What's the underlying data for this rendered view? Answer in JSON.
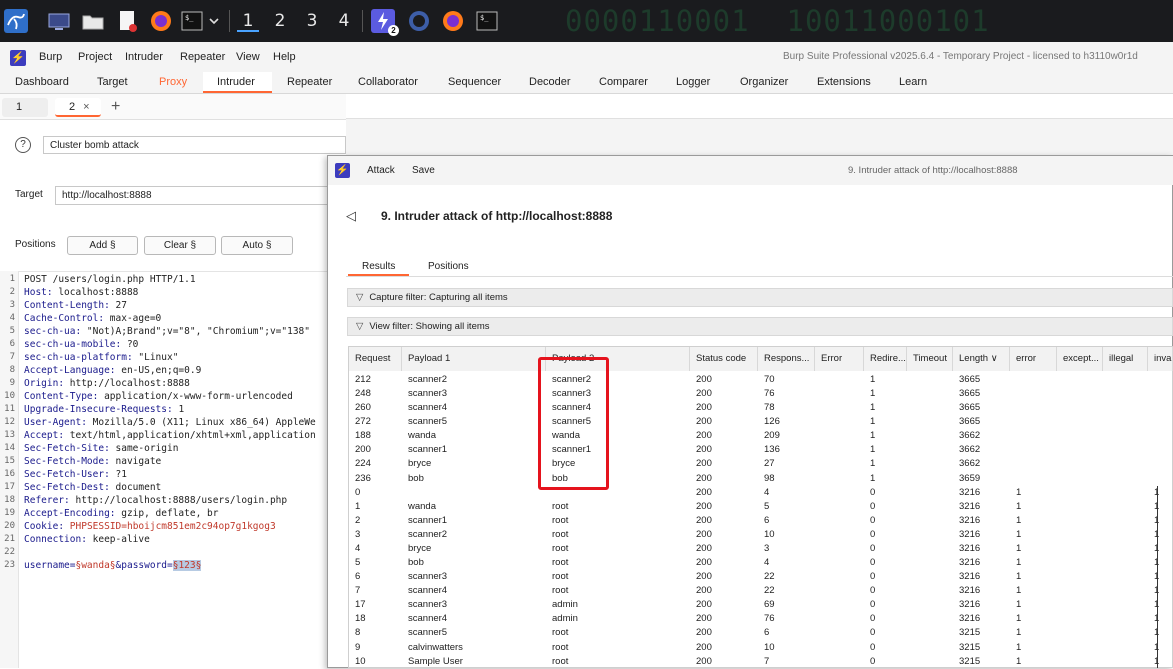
{
  "taskbar": {
    "workspaces": [
      "1",
      "2",
      "3",
      "4"
    ],
    "badge": "2",
    "binary_text": "0000110001  10011000101"
  },
  "menubar": {
    "items": [
      "Burp",
      "Project",
      "Intruder",
      "Repeater",
      "View",
      "Help"
    ],
    "window_title": "Burp Suite Professional v2025.6.4 - Temporary Project - licensed to h3110w0r1d"
  },
  "main_tabs": [
    "Dashboard",
    "Target",
    "Proxy",
    "Intruder",
    "Repeater"
  ],
  "secondary_tabs": [
    "Collaborator",
    "Sequencer",
    "Decoder",
    "Comparer",
    "Logger",
    "Organizer",
    "Extensions",
    "Learn"
  ],
  "intruder_tabs": [
    {
      "label": "1",
      "close": ""
    },
    {
      "label": "2",
      "close": "×"
    }
  ],
  "add_tab": "+",
  "attack_type": "Cluster bomb attack",
  "target": {
    "label": "Target",
    "value": "http://localhost:8888"
  },
  "positions": {
    "label": "Positions",
    "add": "Add §",
    "clear": "Clear §",
    "auto": "Auto §"
  },
  "request_lines": [
    {
      "n": "1",
      "text": "POST /users/login.php HTTP/1.1"
    },
    {
      "n": "2",
      "h": "Host",
      "v": " localhost:8888"
    },
    {
      "n": "3",
      "h": "Content-Length",
      "v": " 27"
    },
    {
      "n": "4",
      "h": "Cache-Control",
      "v": " max-age=0"
    },
    {
      "n": "5",
      "h": "sec-ch-ua",
      "v": " \"Not)A;Brand\";v=\"8\", \"Chromium\";v=\"138\""
    },
    {
      "n": "6",
      "h": "sec-ch-ua-mobile",
      "v": " ?0"
    },
    {
      "n": "7",
      "h": "sec-ch-ua-platform",
      "v": " \"Linux\""
    },
    {
      "n": "8",
      "h": "Accept-Language",
      "v": " en-US,en;q=0.9"
    },
    {
      "n": "9",
      "h": "Origin",
      "v": " http://localhost:8888"
    },
    {
      "n": "10",
      "h": "Content-Type",
      "v": " application/x-www-form-urlencoded"
    },
    {
      "n": "11",
      "h": "Upgrade-Insecure-Requests",
      "v": " 1"
    },
    {
      "n": "12",
      "h": "User-Agent",
      "v": " Mozilla/5.0 (X11; Linux x86_64) AppleWe"
    },
    {
      "n": "13",
      "h": "Accept",
      "v": " text/html,application/xhtml+xml,application"
    },
    {
      "n": "14",
      "h": "Sec-Fetch-Site",
      "v": " same-origin"
    },
    {
      "n": "15",
      "h": "Sec-Fetch-Mode",
      "v": " navigate"
    },
    {
      "n": "16",
      "h": "Sec-Fetch-User",
      "v": " ?1"
    },
    {
      "n": "17",
      "h": "Sec-Fetch-Dest",
      "v": " document"
    },
    {
      "n": "18",
      "h": "Referer",
      "v": " http://localhost:8888/users/login.php"
    },
    {
      "n": "19",
      "h": "Accept-Encoding",
      "v": " gzip, deflate, br"
    },
    {
      "n": "20",
      "h": "Cookie",
      "v": " ",
      "sess": "PHPSESSID=hboijcm851em2c94op7g1kgog3"
    },
    {
      "n": "21",
      "h": "Connection",
      "v": " keep-alive"
    },
    {
      "n": "22",
      "text": ""
    },
    {
      "n": "23",
      "body": true,
      "p1": "username=",
      "pay1": "§wanda§",
      "p2": "&password=",
      "pay2": "§123§"
    }
  ],
  "attack_window": {
    "menu": [
      "Attack",
      "Save"
    ],
    "window_title": "9. Intruder attack of http://localhost:8888",
    "title": "9. Intruder attack of http://localhost:8888",
    "back_icon": "◁",
    "tabs": [
      "Results",
      "Positions"
    ],
    "capture_filter": "Capture filter: Capturing all items",
    "view_filter": "View filter: Showing all items",
    "columns": [
      "Request",
      "Payload 1",
      "Payload 2",
      "Status code",
      "Respons...",
      "Error",
      "Redire...",
      "Timeout",
      "Length ∨",
      "error",
      "except...",
      "illegal",
      "inva"
    ],
    "rows": [
      [
        "212",
        "scanner2",
        "scanner2",
        "200",
        "70",
        "",
        "1",
        "",
        "3665",
        "",
        "",
        "",
        ""
      ],
      [
        "248",
        "scanner3",
        "scanner3",
        "200",
        "76",
        "",
        "1",
        "",
        "3665",
        "",
        "",
        "",
        ""
      ],
      [
        "260",
        "scanner4",
        "scanner4",
        "200",
        "78",
        "",
        "1",
        "",
        "3665",
        "",
        "",
        "",
        ""
      ],
      [
        "272",
        "scanner5",
        "scanner5",
        "200",
        "126",
        "",
        "1",
        "",
        "3665",
        "",
        "",
        "",
        ""
      ],
      [
        "188",
        "wanda",
        "wanda",
        "200",
        "209",
        "",
        "1",
        "",
        "3662",
        "",
        "",
        "",
        ""
      ],
      [
        "200",
        "scanner1",
        "scanner1",
        "200",
        "136",
        "",
        "1",
        "",
        "3662",
        "",
        "",
        "",
        ""
      ],
      [
        "224",
        "bryce",
        "bryce",
        "200",
        "27",
        "",
        "1",
        "",
        "3662",
        "",
        "",
        "",
        ""
      ],
      [
        "236",
        "bob",
        "bob",
        "200",
        "98",
        "",
        "1",
        "",
        "3659",
        "",
        "",
        "",
        ""
      ],
      [
        "0",
        "",
        "",
        "200",
        "4",
        "",
        "0",
        "",
        "3216",
        "1",
        "",
        "",
        "1"
      ],
      [
        "1",
        "wanda",
        "root",
        "200",
        "5",
        "",
        "0",
        "",
        "3216",
        "1",
        "",
        "",
        "1"
      ],
      [
        "2",
        "scanner1",
        "root",
        "200",
        "6",
        "",
        "0",
        "",
        "3216",
        "1",
        "",
        "",
        "1"
      ],
      [
        "3",
        "scanner2",
        "root",
        "200",
        "10",
        "",
        "0",
        "",
        "3216",
        "1",
        "",
        "",
        "1"
      ],
      [
        "4",
        "bryce",
        "root",
        "200",
        "3",
        "",
        "0",
        "",
        "3216",
        "1",
        "",
        "",
        "1"
      ],
      [
        "5",
        "bob",
        "root",
        "200",
        "4",
        "",
        "0",
        "",
        "3216",
        "1",
        "",
        "",
        "1"
      ],
      [
        "6",
        "scanner3",
        "root",
        "200",
        "22",
        "",
        "0",
        "",
        "3216",
        "1",
        "",
        "",
        "1"
      ],
      [
        "7",
        "scanner4",
        "root",
        "200",
        "22",
        "",
        "0",
        "",
        "3216",
        "1",
        "",
        "",
        "1"
      ],
      [
        "17",
        "scanner3",
        "admin",
        "200",
        "69",
        "",
        "0",
        "",
        "3216",
        "1",
        "",
        "",
        "1"
      ],
      [
        "18",
        "scanner4",
        "admin",
        "200",
        "76",
        "",
        "0",
        "",
        "3216",
        "1",
        "",
        "",
        "1"
      ],
      [
        "8",
        "scanner5",
        "root",
        "200",
        "6",
        "",
        "0",
        "",
        "3215",
        "1",
        "",
        "",
        "1"
      ],
      [
        "9",
        "calvinwatters",
        "root",
        "200",
        "10",
        "",
        "0",
        "",
        "3215",
        "1",
        "",
        "",
        "1"
      ],
      [
        "10",
        "Sample User",
        "root",
        "200",
        "7",
        "",
        "0",
        "",
        "3215",
        "1",
        "",
        "",
        "1"
      ]
    ]
  },
  "colors": {
    "accent": "#ff6633",
    "highlight": "#e5131d",
    "burp_logo": "#3c3cbe"
  }
}
